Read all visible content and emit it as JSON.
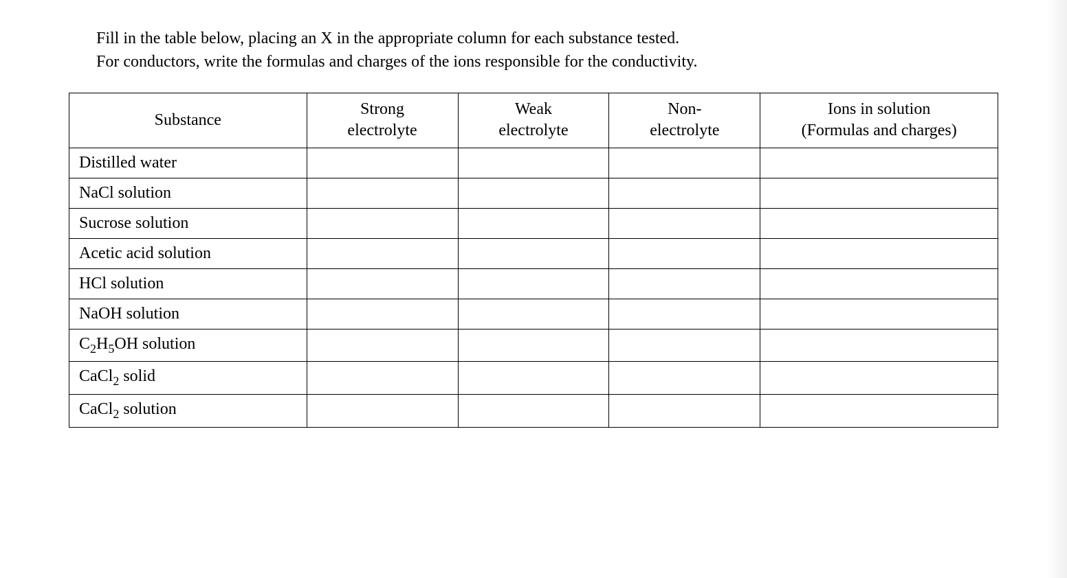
{
  "instructions": {
    "line1": "Fill in the table below, placing an X in the appropriate column for each substance tested.",
    "line2": "For conductors, write the formulas and charges of the ions responsible for the conductivity."
  },
  "table": {
    "headers": {
      "substance": "Substance",
      "strong": "Strong electrolyte",
      "weak": "Weak electrolyte",
      "non": "Non-electrolyte",
      "ions": "Ions in solution (Formulas and charges)"
    },
    "rows": [
      {
        "substance_html": "Distilled water",
        "strong": "",
        "weak": "",
        "non": "",
        "ions": ""
      },
      {
        "substance_html": "NaCl solution",
        "strong": "",
        "weak": "",
        "non": "",
        "ions": ""
      },
      {
        "substance_html": "Sucrose solution",
        "strong": "",
        "weak": "",
        "non": "",
        "ions": ""
      },
      {
        "substance_html": "Acetic acid solution",
        "strong": "",
        "weak": "",
        "non": "",
        "ions": ""
      },
      {
        "substance_html": "HCl solution",
        "strong": "",
        "weak": "",
        "non": "",
        "ions": ""
      },
      {
        "substance_html": "NaOH solution",
        "strong": "",
        "weak": "",
        "non": "",
        "ions": ""
      },
      {
        "substance_html": "C<sub>2</sub>H<sub>5</sub>OH solution",
        "strong": "",
        "weak": "",
        "non": "",
        "ions": ""
      },
      {
        "substance_html": "CaCl<sub>2</sub> solid",
        "strong": "",
        "weak": "",
        "non": "",
        "ions": ""
      },
      {
        "substance_html": "CaCl<sub>2</sub> solution",
        "strong": "",
        "weak": "",
        "non": "",
        "ions": ""
      }
    ]
  }
}
